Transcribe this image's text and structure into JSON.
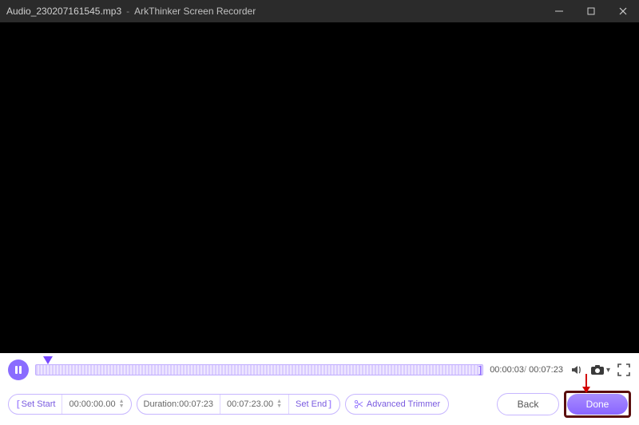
{
  "titlebar": {
    "filename": "Audio_230207161545.mp3",
    "separator": "-",
    "app_name": "ArkThinker Screen Recorder"
  },
  "playback": {
    "current_time": "00:00:03",
    "total_time": "00:07:23"
  },
  "trim": {
    "set_start_label": "Set Start",
    "start_time": "00:00:00.00",
    "duration_label": "Duration:00:07:23",
    "end_time": "00:07:23.00",
    "set_end_label": "Set End",
    "advanced_label": "Advanced Trimmer"
  },
  "actions": {
    "back_label": "Back",
    "done_label": "Done"
  }
}
